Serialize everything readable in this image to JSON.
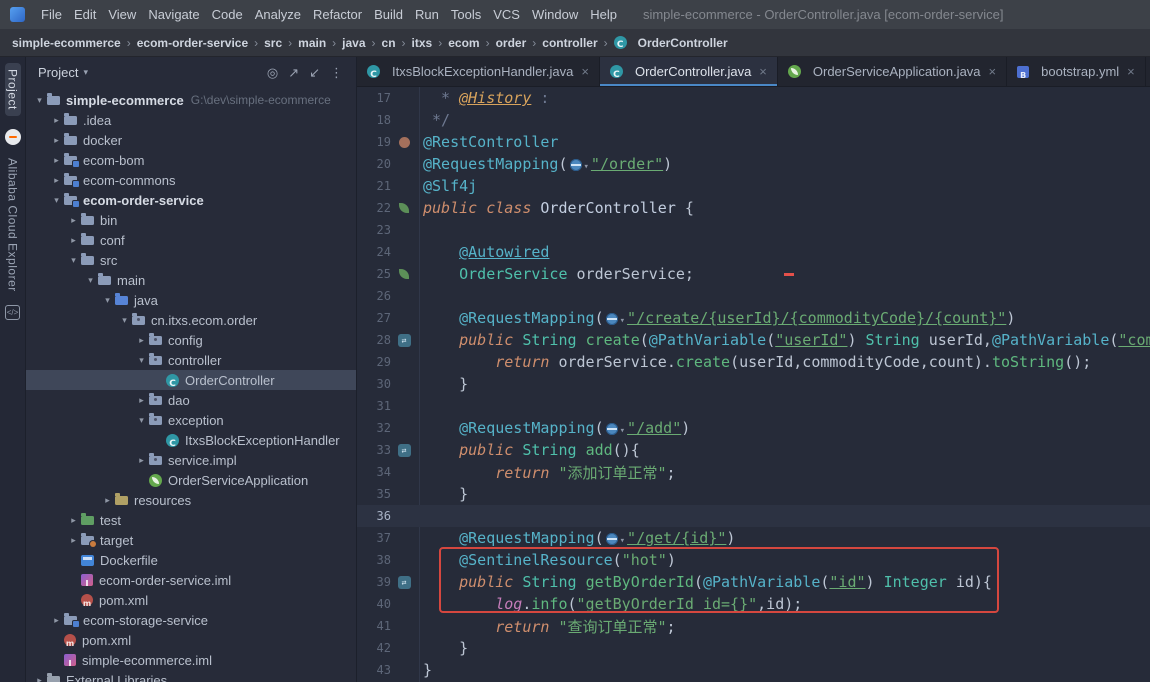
{
  "window": {
    "title": "simple-ecommerce - OrderController.java [ecom-order-service]"
  },
  "menu": {
    "items": [
      "File",
      "Edit",
      "View",
      "Navigate",
      "Code",
      "Analyze",
      "Refactor",
      "Build",
      "Run",
      "Tools",
      "VCS",
      "Window",
      "Help"
    ]
  },
  "breadcrumb": {
    "separator": "›",
    "items": [
      {
        "label": "simple-ecommerce"
      },
      {
        "label": "ecom-order-service"
      },
      {
        "label": "src"
      },
      {
        "label": "main"
      },
      {
        "label": "java"
      },
      {
        "label": "cn"
      },
      {
        "label": "itxs"
      },
      {
        "label": "ecom"
      },
      {
        "label": "order"
      },
      {
        "label": "controller"
      },
      {
        "label": "OrderController",
        "icon": "class"
      }
    ]
  },
  "tool_stripe": {
    "top": "Project",
    "bottom": "Alibaba Cloud Explorer"
  },
  "project_panel": {
    "header": "Project",
    "chevron": "▾",
    "actions": [
      {
        "name": "locate",
        "glyph": "◎"
      },
      {
        "name": "expand-all",
        "glyph": "↗"
      },
      {
        "name": "collapse-all",
        "glyph": "↙"
      },
      {
        "name": "more-options",
        "glyph": "⋮"
      }
    ],
    "tree": [
      {
        "label": "simple-ecommerce",
        "extra": "G:\\dev\\simple-ecommerce",
        "depth": 0,
        "arrow": "exp",
        "icon": "project",
        "bold": true
      },
      {
        "label": ".idea",
        "depth": 1,
        "arrow": "col",
        "icon": "folder"
      },
      {
        "label": "docker",
        "depth": 1,
        "arrow": "col",
        "icon": "folder"
      },
      {
        "label": "ecom-bom",
        "depth": 1,
        "arrow": "col",
        "icon": "module"
      },
      {
        "label": "ecom-commons",
        "depth": 1,
        "arrow": "col",
        "icon": "module"
      },
      {
        "label": "ecom-order-service",
        "depth": 1,
        "arrow": "exp",
        "icon": "module",
        "bold": true
      },
      {
        "label": "bin",
        "depth": 2,
        "arrow": "col",
        "icon": "folder"
      },
      {
        "label": "conf",
        "depth": 2,
        "arrow": "col",
        "icon": "folder"
      },
      {
        "label": "src",
        "depth": 2,
        "arrow": "exp",
        "icon": "folder"
      },
      {
        "label": "main",
        "depth": 3,
        "arrow": "exp",
        "icon": "folder"
      },
      {
        "label": "java",
        "depth": 4,
        "arrow": "exp",
        "icon": "src"
      },
      {
        "label": "cn.itxs.ecom.order",
        "depth": 5,
        "arrow": "exp",
        "icon": "pkg"
      },
      {
        "label": "config",
        "depth": 6,
        "arrow": "col",
        "icon": "pkg"
      },
      {
        "label": "controller",
        "depth": 6,
        "arrow": "exp",
        "icon": "pkg"
      },
      {
        "label": "OrderController",
        "depth": 7,
        "icon": "class",
        "selected": true
      },
      {
        "label": "dao",
        "depth": 6,
        "arrow": "col",
        "icon": "pkg"
      },
      {
        "label": "exception",
        "depth": 6,
        "arrow": "exp",
        "icon": "pkg"
      },
      {
        "label": "ItxsBlockExceptionHandler",
        "depth": 7,
        "icon": "class"
      },
      {
        "label": "service.impl",
        "depth": 6,
        "arrow": "col",
        "icon": "pkg"
      },
      {
        "label": "OrderServiceApplication",
        "depth": 6,
        "icon": "spring"
      },
      {
        "label": "resources",
        "depth": 4,
        "arrow": "col",
        "icon": "res"
      },
      {
        "label": "test",
        "depth": 2,
        "arrow": "col",
        "icon": "test"
      },
      {
        "label": "target",
        "depth": 2,
        "arrow": "col",
        "icon": "folder-ex"
      },
      {
        "label": "Dockerfile",
        "depth": 2,
        "icon": "docker"
      },
      {
        "label": "ecom-order-service.iml",
        "depth": 2,
        "icon": "iml"
      },
      {
        "label": "pom.xml",
        "depth": 2,
        "icon": "maven"
      },
      {
        "label": "ecom-storage-service",
        "depth": 1,
        "arrow": "col",
        "icon": "module"
      },
      {
        "label": "pom.xml",
        "depth": 1,
        "icon": "maven"
      },
      {
        "label": "simple-ecommerce.iml",
        "depth": 1,
        "icon": "iml"
      },
      {
        "label": "External Libraries",
        "depth": 0,
        "arrow": "col",
        "icon": "lib"
      }
    ]
  },
  "editor": {
    "close_glyph": "×",
    "tabs": [
      {
        "label": "ItxsBlockExceptionHandler.java",
        "icon": "class",
        "active": false
      },
      {
        "label": "OrderController.java",
        "icon": "class",
        "active": true
      },
      {
        "label": "OrderServiceApplication.java",
        "icon": "spring",
        "active": false
      },
      {
        "label": "bootstrap.yml",
        "icon": "yml",
        "active": false
      }
    ],
    "lines": [
      {
        "n": 17,
        "t": [
          [
            "  * ",
            "com"
          ],
          [
            "@History",
            "doc"
          ],
          [
            " :",
            "com"
          ]
        ]
      },
      {
        "n": 18,
        "t": [
          [
            " */",
            "com"
          ]
        ]
      },
      {
        "n": 19,
        "g": "bean",
        "t": [
          [
            "@RestController",
            "ann"
          ]
        ]
      },
      {
        "n": 20,
        "t": [
          [
            "@RequestMapping",
            "ann"
          ],
          [
            "(",
            "pln"
          ],
          [
            "",
            "url"
          ],
          [
            "\"/order\"",
            "strU"
          ],
          [
            ")",
            "pln"
          ]
        ]
      },
      {
        "n": 21,
        "t": [
          [
            "@Slf4j",
            "ann"
          ]
        ]
      },
      {
        "n": 22,
        "g": "leaf",
        "t": [
          [
            "public class ",
            "kw"
          ],
          [
            "OrderController ",
            "cls"
          ],
          [
            "{",
            "pln"
          ]
        ]
      },
      {
        "n": 23,
        "t": []
      },
      {
        "n": 24,
        "t": [
          [
            "    ",
            "pln"
          ],
          [
            "@Autowired",
            "annU"
          ]
        ]
      },
      {
        "n": 25,
        "g": "leaf",
        "marker": "dash",
        "t": [
          [
            "    ",
            "pln"
          ],
          [
            "OrderService ",
            "type"
          ],
          [
            "orderService",
            "pln"
          ],
          [
            ";",
            "pln"
          ]
        ]
      },
      {
        "n": 26,
        "t": []
      },
      {
        "n": 27,
        "t": [
          [
            "    ",
            "pln"
          ],
          [
            "@RequestMapping",
            "ann"
          ],
          [
            "(",
            "pln"
          ],
          [
            "",
            "url"
          ],
          [
            "\"/create/{userId}/{commodityCode}/{count}\"",
            "strU"
          ],
          [
            ")",
            "pln"
          ]
        ]
      },
      {
        "n": 28,
        "g": "api",
        "t": [
          [
            "    ",
            "pln"
          ],
          [
            "public ",
            "kw"
          ],
          [
            "String ",
            "type"
          ],
          [
            "create",
            "meth"
          ],
          [
            "(",
            "pln"
          ],
          [
            "@PathVariable",
            "ann"
          ],
          [
            "(",
            "pln"
          ],
          [
            "\"userId\"",
            "strU"
          ],
          [
            ") ",
            "pln"
          ],
          [
            "String ",
            "type"
          ],
          [
            "userId,",
            "pln"
          ],
          [
            "@PathVariable",
            "ann"
          ],
          [
            "(",
            "pln"
          ],
          [
            "\"com",
            "strU"
          ]
        ]
      },
      {
        "n": 29,
        "t": [
          [
            "        ",
            "pln"
          ],
          [
            "return ",
            "kw"
          ],
          [
            "orderService.",
            "pln"
          ],
          [
            "create",
            "meth"
          ],
          [
            "(userId,commodityCode,count).",
            "pln"
          ],
          [
            "toString",
            "meth"
          ],
          [
            "();",
            "pln"
          ]
        ]
      },
      {
        "n": 30,
        "t": [
          [
            "    }",
            "pln"
          ]
        ]
      },
      {
        "n": 31,
        "t": []
      },
      {
        "n": 32,
        "t": [
          [
            "    ",
            "pln"
          ],
          [
            "@RequestMapping",
            "ann"
          ],
          [
            "(",
            "pln"
          ],
          [
            "",
            "url"
          ],
          [
            "\"/add\"",
            "strU"
          ],
          [
            ")",
            "pln"
          ]
        ]
      },
      {
        "n": 33,
        "g": "api",
        "t": [
          [
            "    ",
            "pln"
          ],
          [
            "public ",
            "kw"
          ],
          [
            "String ",
            "type"
          ],
          [
            "add",
            "meth"
          ],
          [
            "(){",
            "pln"
          ]
        ]
      },
      {
        "n": 34,
        "t": [
          [
            "        ",
            "pln"
          ],
          [
            "return ",
            "kw"
          ],
          [
            "\"添加订单正常\"",
            "str"
          ],
          [
            ";",
            "pln"
          ]
        ]
      },
      {
        "n": 35,
        "t": [
          [
            "    }",
            "pln"
          ]
        ]
      },
      {
        "n": 36,
        "cur": true,
        "t": []
      },
      {
        "n": 37,
        "t": [
          [
            "    ",
            "pln"
          ],
          [
            "@RequestMapping",
            "ann"
          ],
          [
            "(",
            "pln"
          ],
          [
            "",
            "url"
          ],
          [
            "\"/get/{id}\"",
            "strU"
          ],
          [
            ")",
            "pln"
          ]
        ]
      },
      {
        "n": 38,
        "t": [
          [
            "    ",
            "pln"
          ],
          [
            "@SentinelResource",
            "ann"
          ],
          [
            "(",
            "pln"
          ],
          [
            "\"hot\"",
            "str"
          ],
          [
            ")",
            "pln"
          ]
        ]
      },
      {
        "n": 39,
        "g": "api",
        "t": [
          [
            "    ",
            "pln"
          ],
          [
            "public ",
            "kw"
          ],
          [
            "String ",
            "type"
          ],
          [
            "getByOrderId",
            "meth"
          ],
          [
            "(",
            "pln"
          ],
          [
            "@PathVariable",
            "ann"
          ],
          [
            "(",
            "pln"
          ],
          [
            "\"id\"",
            "strU"
          ],
          [
            ") ",
            "pln"
          ],
          [
            "Integer ",
            "type"
          ],
          [
            "id){",
            "pln"
          ]
        ]
      },
      {
        "n": 40,
        "t": [
          [
            "        ",
            "pln"
          ],
          [
            "log",
            "fld"
          ],
          [
            ".",
            "pln"
          ],
          [
            "info",
            "meth"
          ],
          [
            "(",
            "pln"
          ],
          [
            "\"getByOrderId id={}\"",
            "str"
          ],
          [
            ",id);",
            "pln"
          ]
        ]
      },
      {
        "n": 41,
        "t": [
          [
            "        ",
            "pln"
          ],
          [
            "return ",
            "kw"
          ],
          [
            "\"查询订单正常\"",
            "str"
          ],
          [
            ";",
            "pln"
          ]
        ]
      },
      {
        "n": 42,
        "t": [
          [
            "    }",
            "pln"
          ]
        ]
      },
      {
        "n": 43,
        "t": [
          [
            "}",
            "pln"
          ]
        ]
      }
    ]
  },
  "colors": {
    "selection": "#3f4759",
    "current_line": "#2c3242",
    "highlight_box": "#d5473f",
    "annotation": "#56b3c9",
    "string": "#6aab73",
    "keyword": "#cf8e6d",
    "editor_bg": "#262b39"
  }
}
